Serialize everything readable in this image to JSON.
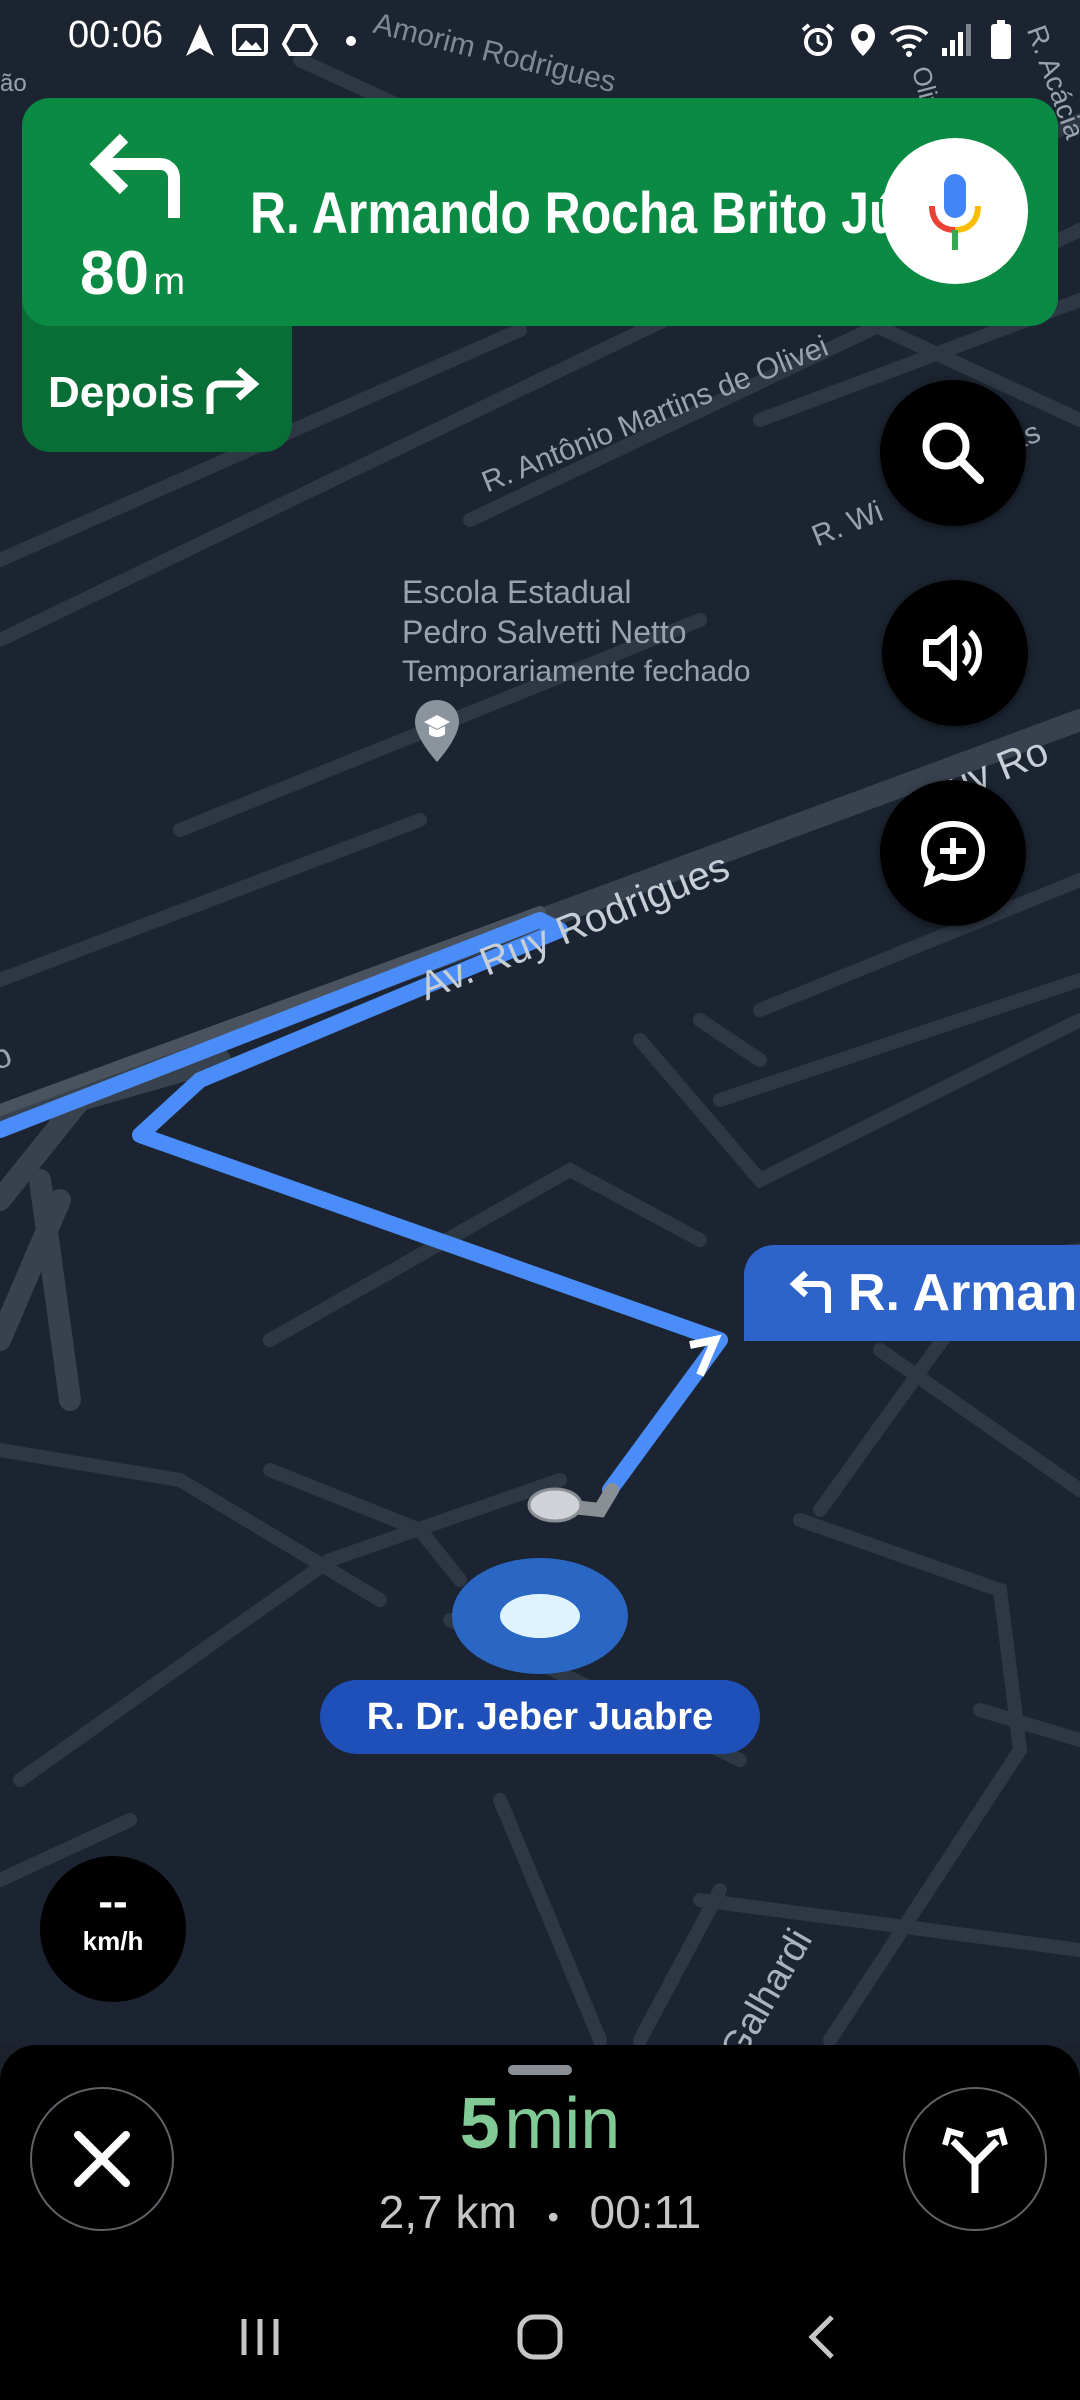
{
  "status_bar": {
    "time": "00:06",
    "left_icons": [
      "navigation-arrow-icon",
      "image-icon",
      "drive-icon",
      "dot-icon"
    ],
    "right_icons": [
      "alarm-icon",
      "location-icon",
      "wifi-icon",
      "signal-icon",
      "battery-icon"
    ]
  },
  "navigation": {
    "turn_icon": "turn-left-icon",
    "distance_value": "80",
    "distance_unit": "m",
    "street": "R. Armando Rocha Brito Júnior",
    "mic_icon": "google-mic-icon"
  },
  "next_turn": {
    "label": "Depois",
    "icon": "turn-right-icon"
  },
  "map_buttons": [
    {
      "name": "search",
      "icon": "search-icon"
    },
    {
      "name": "sound",
      "icon": "volume-icon"
    },
    {
      "name": "report",
      "icon": "add-report-icon"
    }
  ],
  "map": {
    "street_labels": {
      "amorim": "Amorim Rodrigues",
      "antonio": "R. Antônio Martins de Olivei",
      "wi": "R. Wi",
      "as": "as",
      "ruy": "Av. Ruy Rodrigues",
      "ruy_right": "uy Ro",
      "oliveira": "Oliveira",
      "acacia": "R. Acácia",
      "galhardi": "Galhardi",
      "sao": "ão",
      "o_left": "o"
    },
    "poi": {
      "name_line1": "Escola Estadual",
      "name_line2": "Pedro Salvetti Netto",
      "status": "Temporariamente fechado",
      "icon": "school-pin-icon"
    },
    "route_callout": {
      "text": "R. Arman",
      "icon": "turn-left-icon"
    },
    "current_street": "R. Dr. Jeber Juabre",
    "colors": {
      "route": "#4a8df8",
      "map_bg": "#1b2430",
      "road": "#3a4350"
    }
  },
  "speed": {
    "value": "--",
    "unit": "km/h"
  },
  "trip": {
    "duration_value": "5",
    "duration_unit": "min",
    "distance": "2,7 km",
    "separator": "•",
    "arrival": "00:11",
    "eta_color": "#81c995"
  },
  "bottom_buttons": {
    "close_icon": "close-icon",
    "routes_icon": "alternate-routes-icon"
  },
  "system_nav": [
    "recents-icon",
    "home-icon",
    "back-icon"
  ]
}
